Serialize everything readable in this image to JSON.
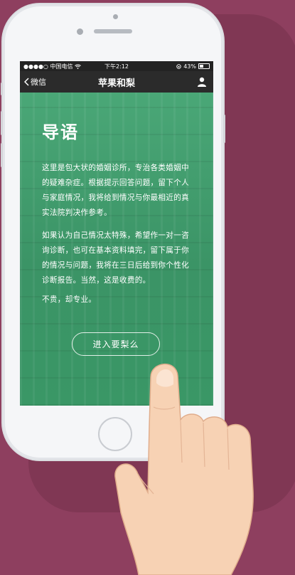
{
  "statusbar": {
    "carrier": "●●●●○ 中国电信",
    "time": "下午2:12",
    "battery": "43%"
  },
  "navbar": {
    "back_label": "微信",
    "title": "苹果和梨"
  },
  "intro": {
    "heading": "导语",
    "paragraph1": "这里是包大状的婚姻诊所，专治各类婚姻中的疑难杂症。根据提示回答问题，留下个人与家庭情况，我将给到情况与你最相近的真实法院判决作参考。",
    "paragraph2": "如果认为自己情况太特殊，希望作一对一咨询诊断，也可在基本资料填完，留下属于你的情况与问题，我将在三日后给到你个性化诊断报告。当然，这是收费的。",
    "paragraph3": "不贵，却专业。",
    "enter_button": "进入要梨么"
  },
  "colors": {
    "background": "#8e3f5f",
    "screen_green": "#3f9a6a",
    "navbar": "#2b2b2b"
  }
}
